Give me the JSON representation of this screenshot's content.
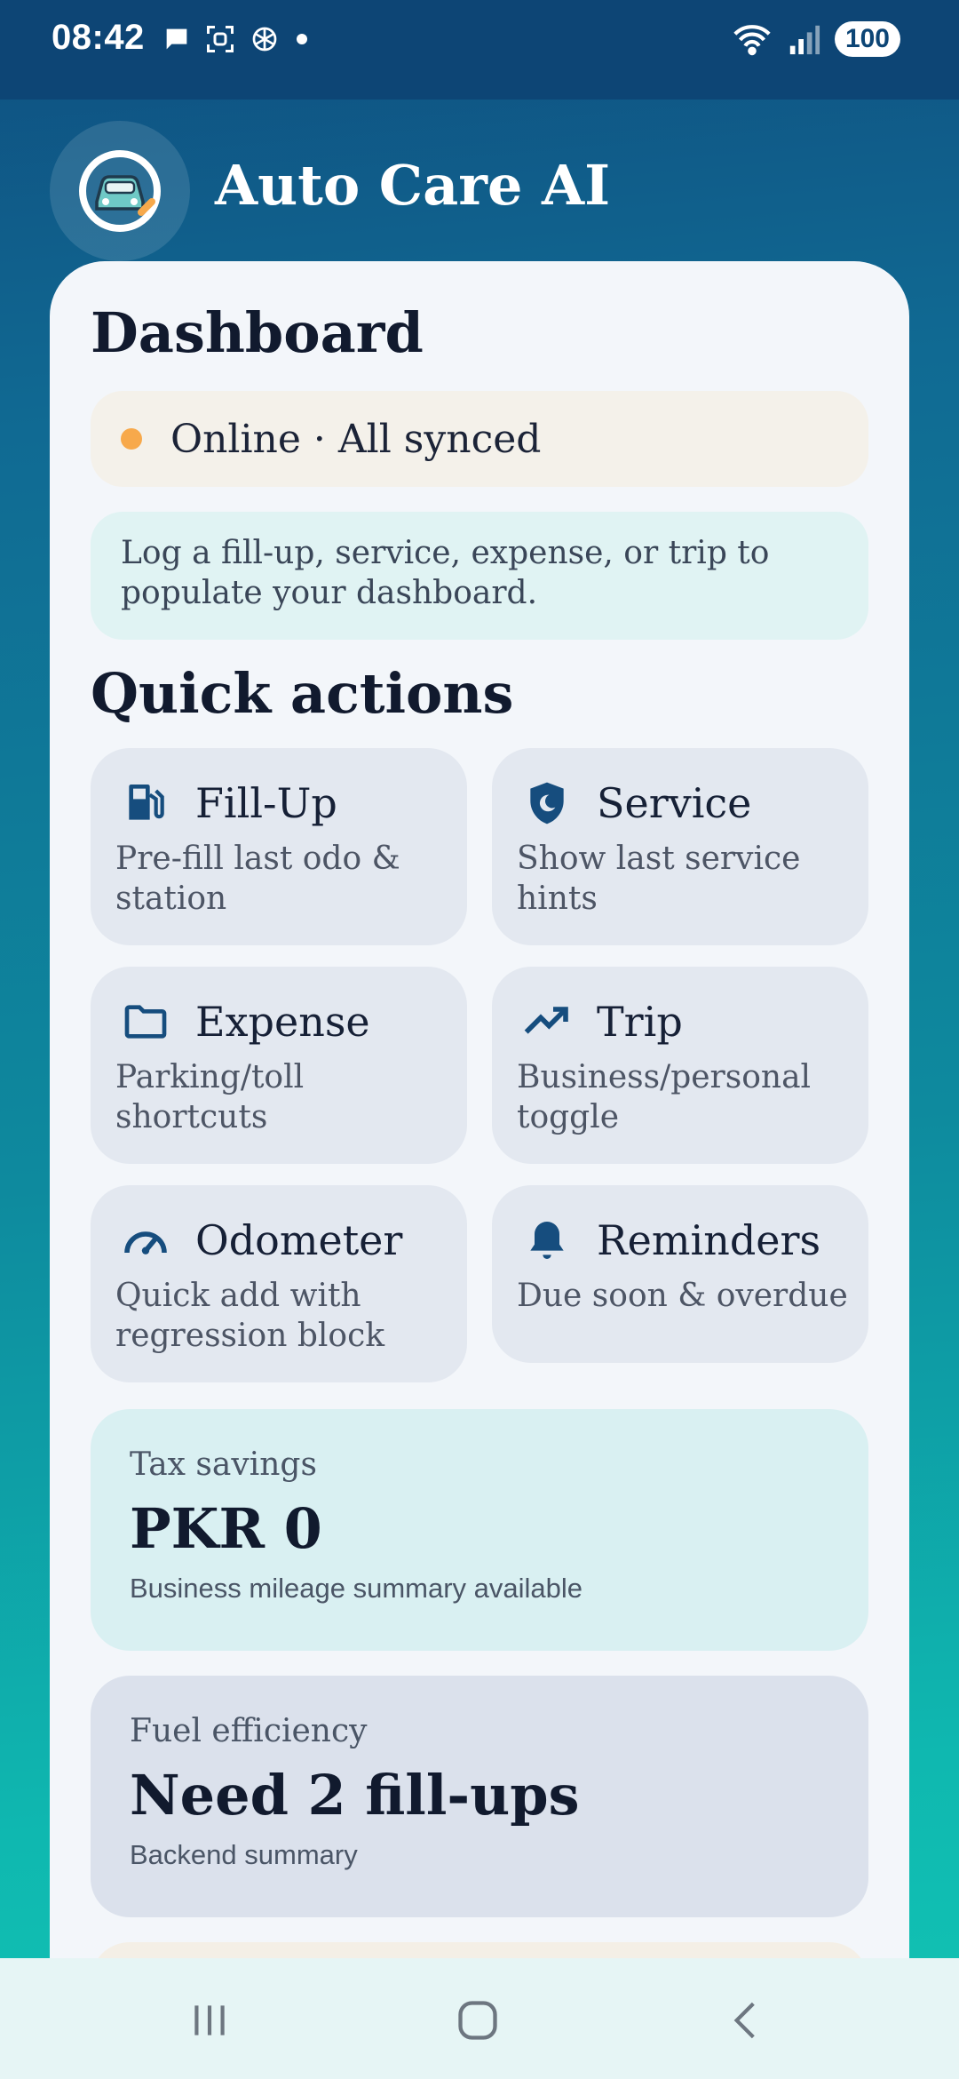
{
  "status_bar": {
    "time": "08:42",
    "battery": "100"
  },
  "app": {
    "title": "Auto Care AI"
  },
  "dashboard": {
    "title": "Dashboard",
    "status": "Online · All synced",
    "info": "Log a fill-up, service, expense, or trip to populate your dashboard."
  },
  "quick_actions": {
    "title": "Quick actions",
    "items": [
      {
        "label": "Fill-Up",
        "desc": "Pre-fill last odo & station",
        "icon": "fuel-pump-icon"
      },
      {
        "label": "Service",
        "desc": "Show last service hints",
        "icon": "shield-icon"
      },
      {
        "label": "Expense",
        "desc": "Parking/toll shortcuts",
        "icon": "folder-icon"
      },
      {
        "label": "Trip",
        "desc": "Business/personal toggle",
        "icon": "trending-up-icon"
      },
      {
        "label": "Odometer",
        "desc": "Quick add with regression block",
        "icon": "speedometer-icon"
      },
      {
        "label": "Reminders",
        "desc": "Due soon & overdue",
        "icon": "bell-icon"
      }
    ]
  },
  "tax": {
    "label": "Tax savings",
    "value": "PKR 0",
    "sub": "Business mileage summary available"
  },
  "fuel": {
    "label": "Fuel efficiency",
    "value": "Need 2 fill-ups",
    "sub": "Backend summary"
  },
  "colors": {
    "accent": "#0f4f80",
    "online_dot": "#f7a94b",
    "icon": "#164d7e"
  }
}
